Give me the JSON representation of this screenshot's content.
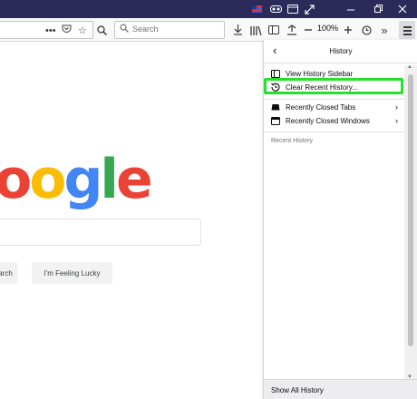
{
  "window": {
    "titlebar_color": "#2b2a59",
    "titlebar_icons": [
      "flag-icon",
      "mask-icon",
      "restore-tab-icon",
      "fullscreen-icon",
      "minimize-icon",
      "maximize-icon",
      "close-icon"
    ]
  },
  "toolbar": {
    "search_placeholder": "Search",
    "zoom_level": "100%"
  },
  "page": {
    "logo_text": "oogle",
    "logo_colors": [
      "#ea4335",
      "#fbbc05",
      "#4285f4",
      "#34a853",
      "#ea4335"
    ],
    "search_button": "arch",
    "lucky_button": "I'm Feeling Lucky"
  },
  "history_panel": {
    "title": "History",
    "items": [
      {
        "label": "View History Sidebar",
        "icon": "sidebar-icon"
      },
      {
        "label": "Clear Recent History...",
        "icon": "history-clock-icon"
      },
      {
        "label": "Recently Closed Tabs",
        "icon": "tab-icon"
      },
      {
        "label": "Recently Closed Windows",
        "icon": "window-icon"
      }
    ],
    "recent_heading": "Recent History",
    "footer_label": "Show All History",
    "highlight_color": "#24e12c"
  }
}
